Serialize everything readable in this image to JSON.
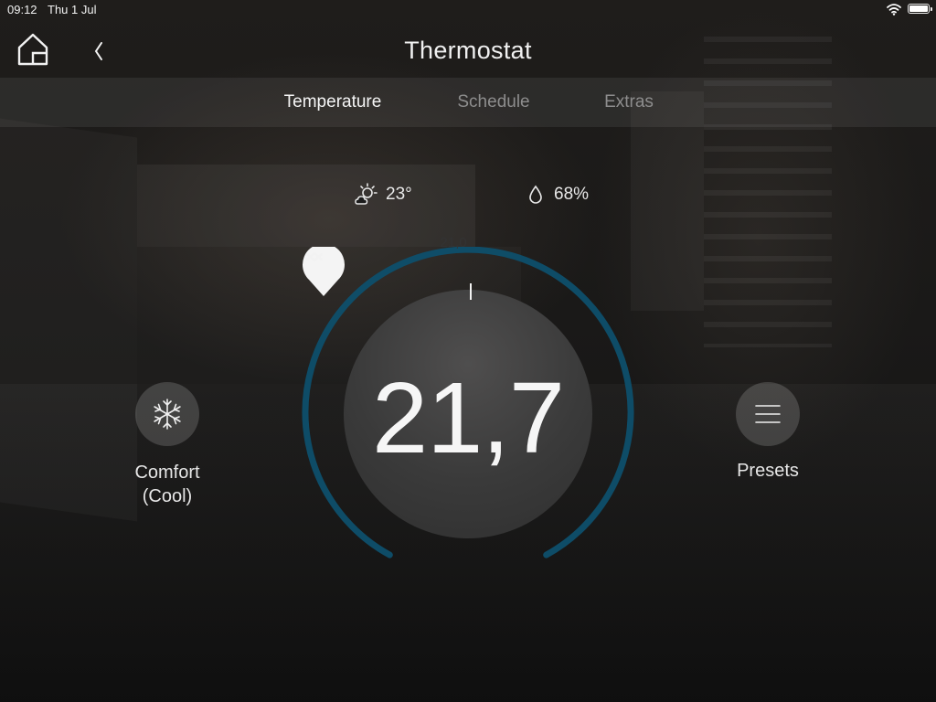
{
  "status_bar": {
    "time": "09:12",
    "date": "Thu 1 Jul",
    "wifi_icon": "wifi-icon",
    "battery_icon": "battery-icon"
  },
  "header": {
    "title": "Thermostat",
    "home_icon": "home-icon",
    "back_icon": "chevron-left-icon"
  },
  "tabs": [
    {
      "label": "Temperature",
      "active": true
    },
    {
      "label": "Schedule",
      "active": false
    },
    {
      "label": "Extras",
      "active": false
    }
  ],
  "weather": {
    "outdoor_temp": "23°",
    "outdoor_icon": "partly-sunny-icon",
    "humidity": "68%",
    "humidity_icon": "water-drop-icon"
  },
  "dial": {
    "current_temperature": "21,7",
    "setpoint": "21,0",
    "decrease_icon": "chevron-down-icon",
    "increase_icon": "chevron-up-icon"
  },
  "mode": {
    "label_line1": "Comfort",
    "label_line2": "(Cool)",
    "icon": "snowflake-icon"
  },
  "presets": {
    "label": "Presets",
    "icon": "menu-icon"
  },
  "colors": {
    "arc": "#0e4f6c",
    "background": "#1a1918",
    "active_tab": "#f5f5f5",
    "inactive_tab": "#8d8d8d"
  }
}
